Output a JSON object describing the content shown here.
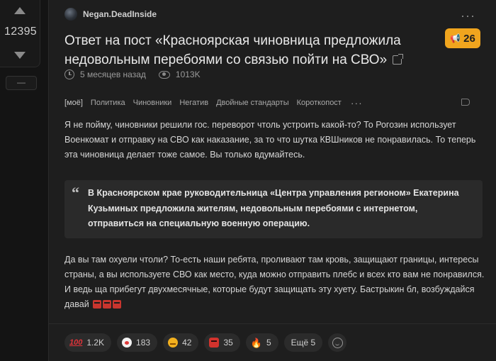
{
  "rating": {
    "score": "12395",
    "collapse_label": "—"
  },
  "post": {
    "author": "Negan.DeadInside",
    "title": "Ответ на пост «Красноярская чиновница предложила недовольным перебоями со связью пойти на СВО»",
    "comments_count": "26",
    "time_ago": "5 месяцев назад",
    "views": "1013K",
    "tags": [
      "[моё]",
      "Политика",
      "Чиновники",
      "Негатив",
      "Двойные стандарты",
      "Короткопост"
    ],
    "tags_more": "···",
    "menu": "···",
    "paragraph1": "Я не пойму, чиновники решили гос. переворот чтоль устроить какой-то? То Рогозин использует Военкомат и отправку на СВО как наказание, за то что шутка КВШников не понравилась. То теперь эта чиновница делает тоже самое. Вы только вдумайтесь.",
    "quote_mark": "“",
    "quote": "В Красноярском крае руководительница «Центра управления регионом» Екатерина Кузьминых предложила жителям, недовольным перебоями с интернетом, отправиться на специальную военную операцию.",
    "paragraph2": "Да вы там охуели чтоли? То-есть наши ребята, проливают там кровь, защищают границы, интересы страны, а вы используете СВО как место, куда можно отправить плебс и всех кто вам не понравился. И ведь ща прибегут двухмесячные, которые будут защищать эту хуету. Бастрыкин бл, возбуждайся давай"
  },
  "reactions": [
    {
      "icon": "hundred-icon",
      "count": "1.2K"
    },
    {
      "icon": "clown-icon",
      "count": "183"
    },
    {
      "icon": "grin-icon",
      "count": "42"
    },
    {
      "icon": "angry-icon",
      "count": "35"
    },
    {
      "icon": "fire-icon",
      "count": "5"
    }
  ],
  "reactions_more": "Ещё 5",
  "colors": {
    "accent": "#f0a51e",
    "background": "#141414",
    "card": "#1e1e1e"
  }
}
